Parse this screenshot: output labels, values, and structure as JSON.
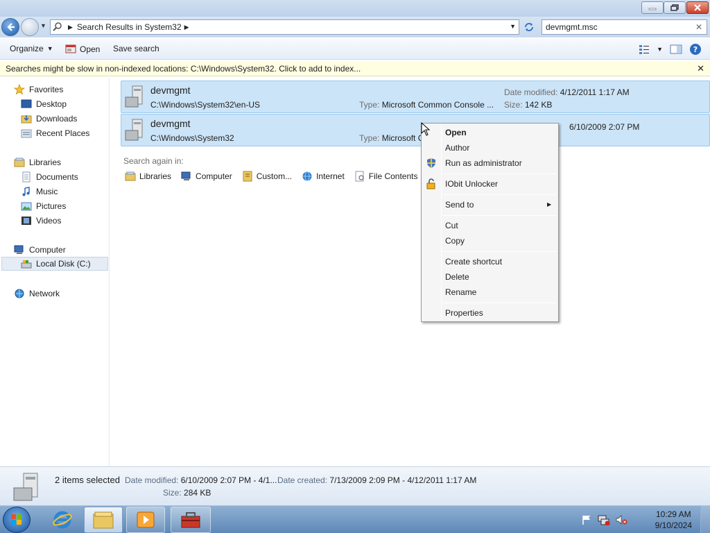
{
  "window": {
    "buttons": {
      "minimize": "minimize",
      "maximize": "restore",
      "close": "close"
    }
  },
  "nav": {
    "address_parts": [
      "Search Results in System32"
    ],
    "search_value": "devmgmt.msc"
  },
  "toolbar": {
    "organize": "Organize",
    "open": "Open",
    "save_search": "Save search"
  },
  "infobar": {
    "text": "Searches might be slow in non-indexed locations: C:\\Windows\\System32. Click to add to index..."
  },
  "sidebar": {
    "favorites": "Favorites",
    "desktop": "Desktop",
    "downloads": "Downloads",
    "recent": "Recent Places",
    "libraries": "Libraries",
    "documents": "Documents",
    "music": "Music",
    "pictures": "Pictures",
    "videos": "Videos",
    "computer": "Computer",
    "local_disk": "Local Disk (C:)",
    "network": "Network"
  },
  "results": [
    {
      "name": "devmgmt",
      "path": "C:\\Windows\\System32\\en-US",
      "type_label": "Type:",
      "type": "Microsoft Common Console ...",
      "dm_label": "Date modified:",
      "dm": "4/12/2011 1:17 AM",
      "size_label": "Size:",
      "size": "142 KB"
    },
    {
      "name": "devmgmt",
      "path": "C:\\Windows\\System32",
      "type_label": "Type:",
      "type": "Microsoft C",
      "dm": "6/10/2009 2:07 PM"
    }
  ],
  "search_again": {
    "label": "Search again in:",
    "items": [
      "Libraries",
      "Computer",
      "Custom...",
      "Internet",
      "File Contents"
    ]
  },
  "context_menu": {
    "items": [
      "Open",
      "Author",
      "Run as administrator",
      "IObit Unlocker",
      "Send to",
      "Cut",
      "Copy",
      "Create shortcut",
      "Delete",
      "Rename",
      "Properties"
    ]
  },
  "details": {
    "selected": "2 items selected",
    "dm_label": "Date modified:",
    "dm": "6/10/2009 2:07 PM - 4/1...",
    "dc_label": "Date created:",
    "dc": "7/13/2009 2:09 PM - 4/12/2011 1:17 AM",
    "size_label": "Size:",
    "size": "284 KB"
  },
  "taskbar": {
    "time": "10:29 AM",
    "date": "9/10/2024"
  },
  "colors": {
    "selection": "#cce4f7",
    "infobar": "#fffee1",
    "taskbar": "#5e88b8"
  }
}
